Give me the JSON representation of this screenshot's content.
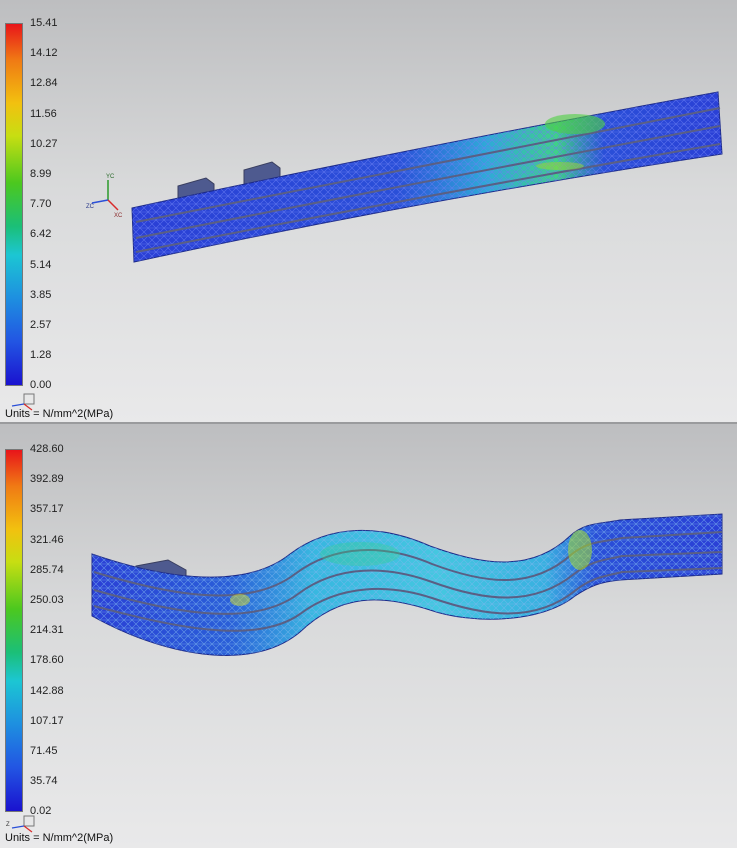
{
  "top_panel": {
    "legend_values": [
      "15.41",
      "14.12",
      "12.84",
      "11.56",
      "10.27",
      "8.99",
      "7.70",
      "6.42",
      "5.14",
      "3.85",
      "2.57",
      "1.28",
      "0.00"
    ],
    "units": "Units = N/mm^2(MPa)",
    "axis_labels": {
      "y": "YC",
      "z": "ZC",
      "x": "XC"
    }
  },
  "bottom_panel": {
    "legend_values": [
      "428.60",
      "392.89",
      "357.17",
      "321.46",
      "285.74",
      "250.03",
      "214.31",
      "178.60",
      "142.88",
      "107.17",
      "71.45",
      "35.74",
      "0.02"
    ],
    "units": "Units = N/mm^2(MPa)",
    "axis_labels": {
      "z": "Z"
    }
  },
  "colors": {
    "max": "#e8151a",
    "mid": "#4cc81f",
    "min": "#1a12cf",
    "mesh_blue": "#2a3fd6",
    "mesh_cyan": "#38b7e0"
  },
  "icons": [
    "coordinate-triad-icon",
    "view-triad-icon"
  ]
}
